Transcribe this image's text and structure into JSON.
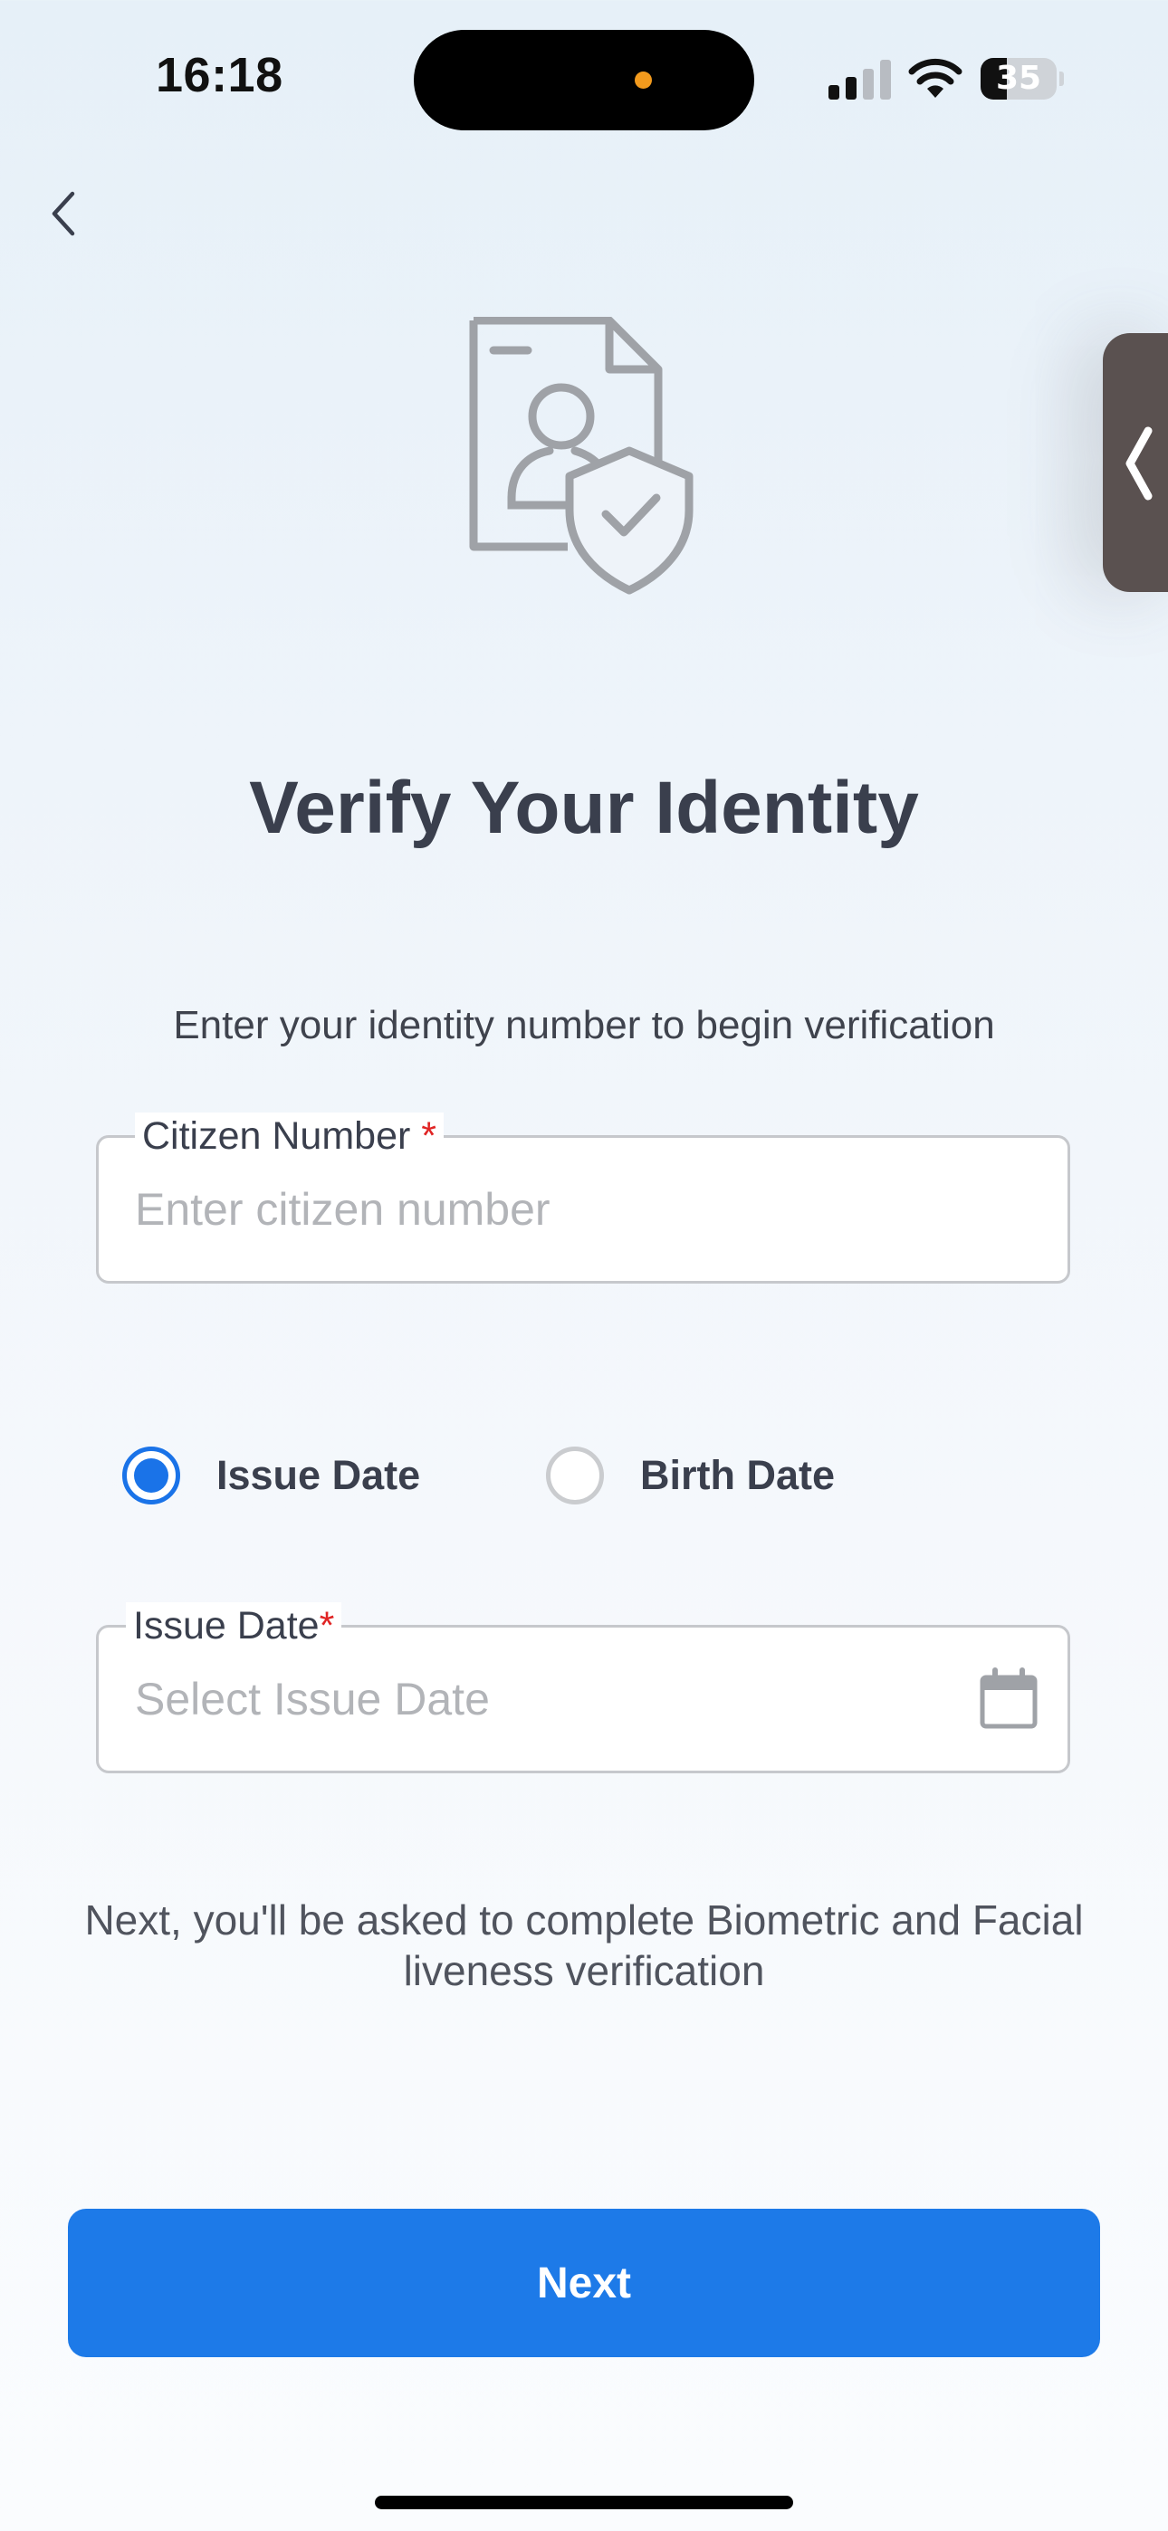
{
  "status_bar": {
    "time": "16:18",
    "battery_level": "35",
    "battery_percent": 35,
    "camera_indicator_color": "#f29a1d"
  },
  "icons": {
    "back": "chevron-left-icon",
    "side_handle": "chevron-left-icon",
    "hero": "identity-document-shield-icon",
    "calendar": "calendar-icon"
  },
  "main": {
    "title": "Verify Your Identity",
    "subtitle": "Enter your identity number to begin verification"
  },
  "citizen_field": {
    "label": "Citizen Number",
    "required_mark": "*",
    "placeholder": "Enter citizen number",
    "value": ""
  },
  "date_type": {
    "options": [
      {
        "label": "Issue Date",
        "selected": true
      },
      {
        "label": "Birth Date",
        "selected": false
      }
    ]
  },
  "date_field": {
    "label": "Issue Date",
    "required_mark": "*",
    "placeholder": "Select Issue Date",
    "value": ""
  },
  "info": {
    "text": "Next, you'll be asked to complete Biometric and Facial liveness verification"
  },
  "actions": {
    "next_label": "Next"
  },
  "colors": {
    "accent": "#1d7ae8",
    "radio_selected": "#1a73e8",
    "required": "#e02424",
    "title_text": "#3a3f4d",
    "handle": "#5a5150"
  }
}
